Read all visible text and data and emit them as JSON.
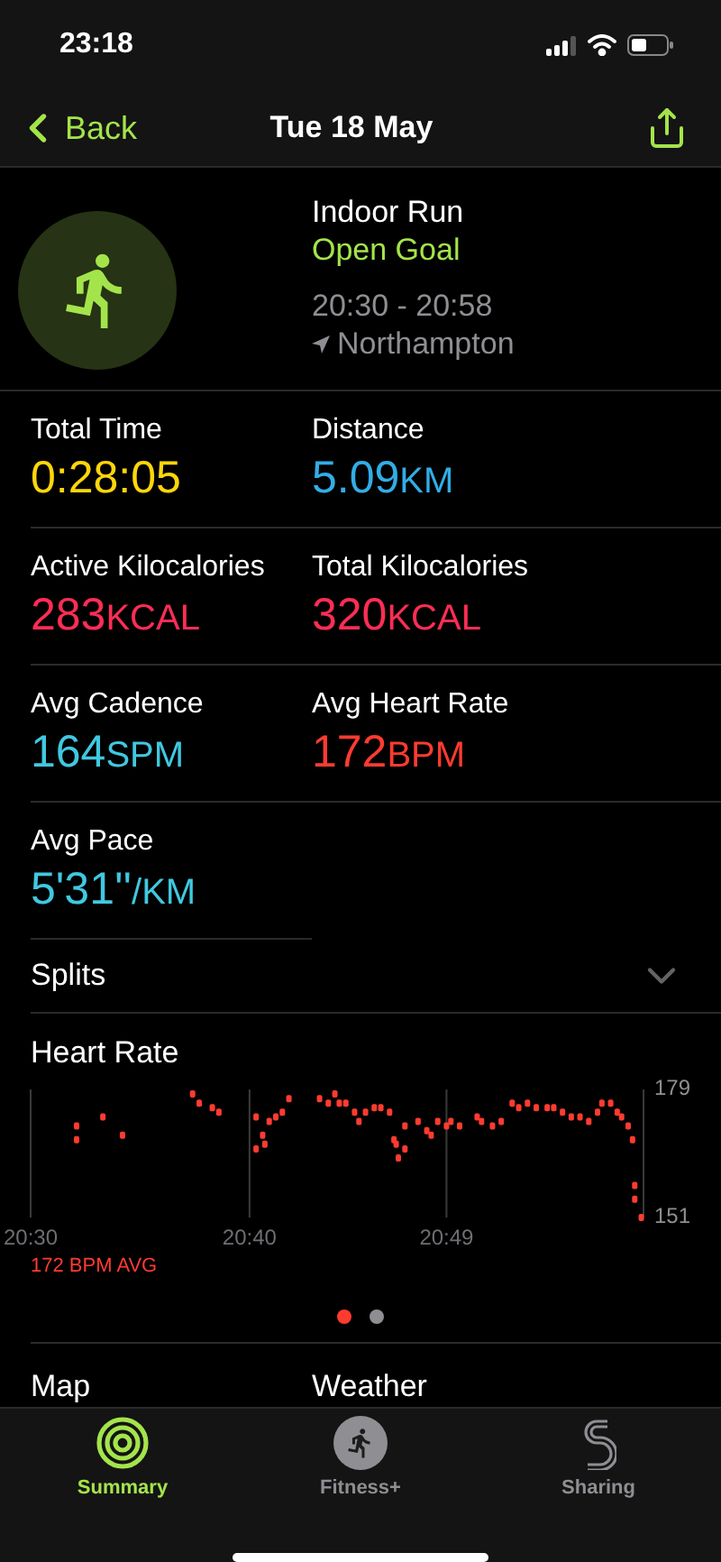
{
  "status_bar": {
    "time": "23:18"
  },
  "nav": {
    "back": "Back",
    "title": "Tue 18 May"
  },
  "workout": {
    "name": "Indoor Run",
    "goal": "Open Goal",
    "time_range": "20:30 - 20:58",
    "location": "Northampton"
  },
  "metrics": [
    {
      "label": "Total Time",
      "value": "0:28:05",
      "color": "#ffd60a"
    },
    {
      "label": "Distance",
      "value": "5.09",
      "unit": "KM",
      "color": "#32ade6"
    },
    {
      "label": "Active Kilocalories",
      "value": "283",
      "unit": "KCAL",
      "color": "#ff2d55"
    },
    {
      "label": "Total Kilocalories",
      "value": "320",
      "unit": "KCAL",
      "color": "#ff2d55"
    },
    {
      "label": "Avg Cadence",
      "value": "164",
      "unit": "SPM",
      "color": "#40c8e0"
    },
    {
      "label": "Avg Heart Rate",
      "value": "172",
      "unit": "BPM",
      "color": "#ff3b30"
    },
    {
      "label": "Avg Pace",
      "value": "5'31''",
      "unit": "/KM",
      "color": "#40c8e0"
    }
  ],
  "splits": {
    "label": "Splits",
    "expanded": false
  },
  "heart_rate": {
    "title": "Heart Rate",
    "average": "172 BPM AVG",
    "chart_data": {
      "type": "scatter",
      "x": [
        1232.1,
        1232.1,
        1233.3,
        1234.2,
        1237.4,
        1237.7,
        1238.3,
        1238.6,
        1240.3,
        1240.3,
        1240.6,
        1240.7,
        1240.9,
        1241.2,
        1241.5,
        1241.8,
        1243.2,
        1243.6,
        1243.9,
        1244.1,
        1244.4,
        1244.8,
        1245.0,
        1245.3,
        1245.7,
        1246.0,
        1246.4,
        1246.6,
        1246.7,
        1246.8,
        1247.1,
        1247.1,
        1247.7,
        1248.1,
        1248.3,
        1248.6,
        1249.0,
        1249.2,
        1249.6,
        1250.4,
        1250.6,
        1251.1,
        1251.5,
        1252.0,
        1252.3,
        1252.7,
        1253.1,
        1253.6,
        1253.9,
        1254.3,
        1254.7,
        1255.1,
        1255.5,
        1255.9,
        1256.1,
        1256.5,
        1256.8,
        1257.0,
        1257.3,
        1257.5,
        1257.6,
        1257.6,
        1257.9
      ],
      "series": [
        {
          "color": "#ff3b30",
          "values": [
            171,
            168,
            173,
            169,
            178,
            176,
            175,
            174,
            173,
            166,
            169,
            167,
            172,
            173,
            174,
            177,
            177,
            176,
            178,
            176,
            176,
            174,
            172,
            174,
            175,
            175,
            174,
            168,
            167,
            164,
            171,
            166,
            172,
            170,
            169,
            172,
            171,
            172,
            171,
            173,
            172,
            171,
            172,
            176,
            175,
            176,
            175,
            175,
            175,
            174,
            173,
            173,
            172,
            174,
            176,
            176,
            174,
            173,
            171,
            168,
            158,
            155,
            151
          ]
        }
      ],
      "xlim": [
        1230,
        1258
      ],
      "ylim": [
        151,
        179
      ],
      "xticks": [
        {
          "value": 1230,
          "label": "20:30"
        },
        {
          "value": 1240,
          "label": "20:40"
        },
        {
          "value": 1249,
          "label": "20:49"
        }
      ],
      "yticks": [
        151,
        179
      ]
    }
  },
  "page_dots": [
    {
      "selected": true
    },
    {
      "selected": false
    }
  ],
  "sections": [
    "Map",
    "Weather"
  ],
  "tab_bar": [
    {
      "kind": "rings",
      "label": "Summary",
      "selected": true
    },
    {
      "kind": "fitness",
      "label": "Fitness+",
      "selected": false
    },
    {
      "kind": "sharing",
      "label": "Sharing",
      "selected": false
    }
  ]
}
